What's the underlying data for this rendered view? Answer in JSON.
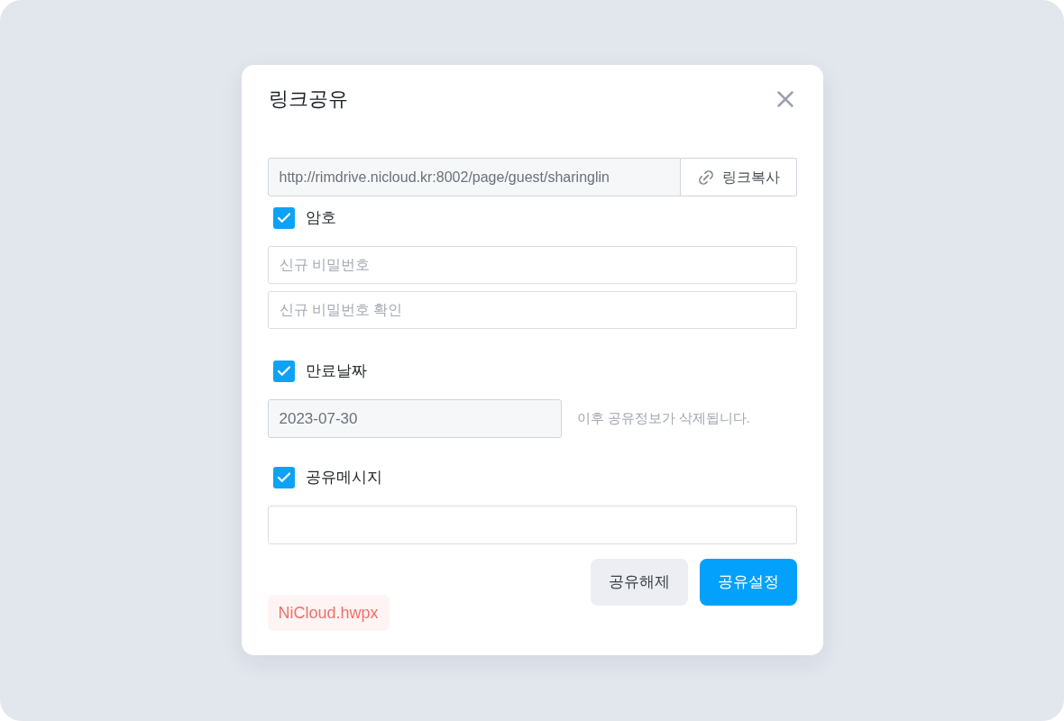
{
  "dialog": {
    "title": "링크공유",
    "link": {
      "url": "http://rimdrive.nicloud.kr:8002/page/guest/sharinglin",
      "copy_button": "링크복사"
    },
    "password": {
      "label": "암호",
      "checked": true,
      "fields": [
        {
          "placeholder": "신규 비밀번호"
        },
        {
          "placeholder": "신규 비밀번호 확인"
        }
      ]
    },
    "expiry": {
      "label": "만료날짜",
      "checked": true,
      "date": "2023-07-30",
      "note": "이후 공유정보가 삭제됩니다."
    },
    "message": {
      "label": "공유메시지",
      "checked": true
    },
    "buttons": [
      {
        "label": "공유해제",
        "kind": "secondary"
      },
      {
        "label": "공유설정",
        "kind": "primary"
      }
    ],
    "file_name": "NiCloud.hwpx"
  }
}
